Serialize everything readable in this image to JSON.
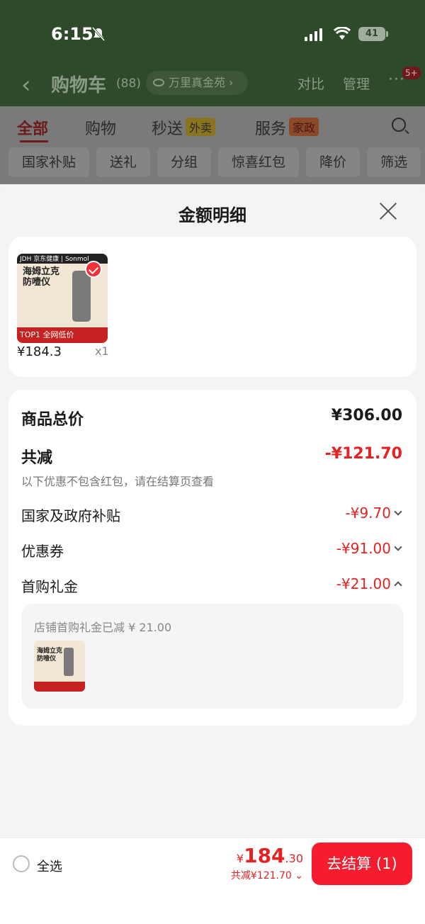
{
  "status_bar": {
    "time": "6:15",
    "battery": "41"
  },
  "header": {
    "title": "购物车",
    "count": "(88)",
    "address": "万里真金苑",
    "compare": "对比",
    "manage": "管理",
    "more_badge": "5+"
  },
  "tabs": [
    {
      "label": "全部"
    },
    {
      "label": "购物"
    },
    {
      "label": "秒送",
      "tag": "外卖"
    },
    {
      "label": "服务",
      "tag": "家政"
    }
  ],
  "chips": [
    "国家补贴",
    "送礼",
    "分组",
    "惊喜红包",
    "降价",
    "筛选"
  ],
  "sheet": {
    "title": "金额明细",
    "product": {
      "image_text_top": "JDH 京东健康 | Sonmol",
      "image_text_title": "海姆立克\n防噎仪",
      "image_text_strip": "TOP1  全网低价",
      "price": "¥184.3",
      "qty": "x1"
    },
    "rows": {
      "total_label": "商品总价",
      "total_value": "¥306.00",
      "discount_label": "共减",
      "discount_value": "-¥121.70",
      "note": "以下优惠不包含红包，请在结算页查看",
      "subsidy_label": "国家及政府补贴",
      "subsidy_value": "-¥9.70",
      "coupon_label": "优惠券",
      "coupon_value": "-¥91.00",
      "gift_label": "首购礼金",
      "gift_value": "-¥21.00"
    },
    "gift_detail": "店铺首购礼金已减 ¥ 21.00"
  },
  "bottom": {
    "select_all": "全选",
    "total_yen": "¥",
    "total_int": "184",
    "total_dec": ".30",
    "saved": "共减¥121.70",
    "checkout": "去结算 (1)"
  }
}
